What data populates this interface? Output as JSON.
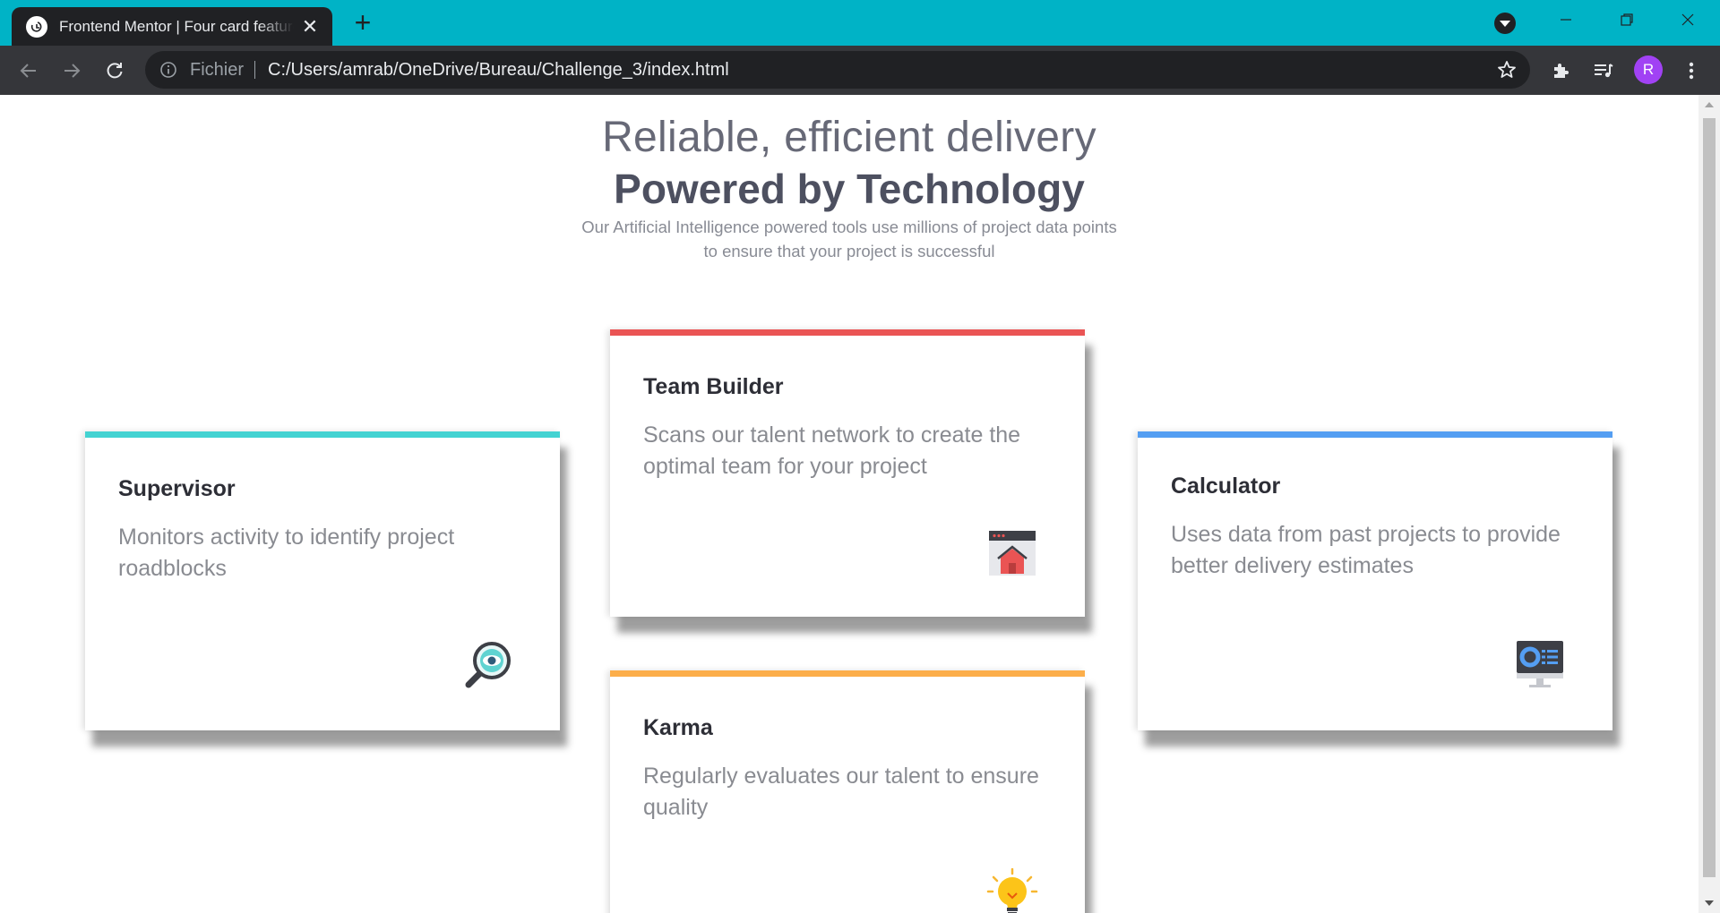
{
  "browser": {
    "tab_title": "Frontend Mentor | Four card feature section",
    "omnibox_scheme": "Fichier",
    "omnibox_url": "C:/Users/amrab/OneDrive/Bureau/Challenge_3/index.html",
    "profile_initial": "R",
    "colors": {
      "frame": "#00b3c6",
      "toolbar": "#35363a",
      "tab": "#202124",
      "avatar": "#a142f4"
    }
  },
  "page": {
    "header": {
      "line1": "Reliable, efficient delivery",
      "line2": "Powered by Technology",
      "description": "Our Artificial Intelligence powered tools use millions of project data points to ensure that your project is successful"
    },
    "cards": [
      {
        "title": "Supervisor",
        "description": "Monitors activity to identify project roadblocks",
        "icon": "magnifier-eye-icon",
        "accent": "#44d3d2"
      },
      {
        "title": "Team Builder",
        "description": "Scans our talent network to create the optimal team for your project",
        "icon": "team-builder-icon",
        "accent": "#ea5454"
      },
      {
        "title": "Karma",
        "description": "Regularly evaluates our talent to ensure quality",
        "icon": "lightbulb-icon",
        "accent": "#fcae4a"
      },
      {
        "title": "Calculator",
        "description": "Uses data from past projects to provide better delivery estimates",
        "icon": "computer-chart-icon",
        "accent": "#549ef2"
      }
    ]
  }
}
